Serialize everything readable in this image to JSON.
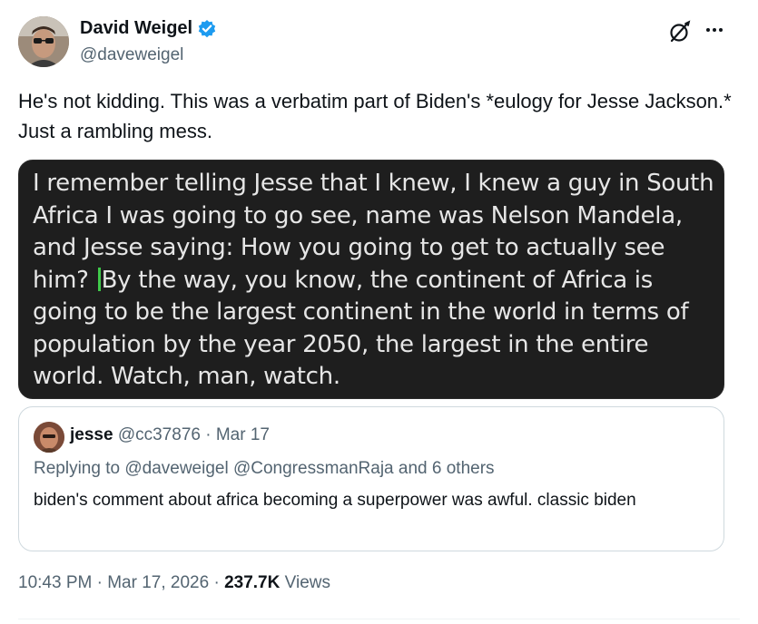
{
  "author": {
    "name": "David Weigel",
    "handle": "@daveweigel",
    "verified_color": "#1d9bf0"
  },
  "tweet": {
    "text": "He's not kidding. This was a verbatim part of Biden's *eulogy for Jesse Jackson.* Just a rambling mess."
  },
  "media": {
    "text_before_cursor": "I remember telling Jesse that I knew, I knew a guy in South Africa I was going to go see, name was Nelson Mandela, and Jesse saying: How you going to get to actually see him?",
    "text_after_cursor": "By the way, you know, the continent of Africa is going to be the largest continent in the world in terms of population by the year 2050, the largest in the entire world. Watch, man, watch.",
    "background": "#1e1e1e",
    "cursor_color": "#3fc94a"
  },
  "quote": {
    "name": "jesse",
    "handle": "@cc37876",
    "separator": "·",
    "date": "Mar 17",
    "replying_prefix": "Replying to ",
    "replying_mentions": "@daveweigel @CongressmanRaja",
    "replying_suffix": " and 6 others",
    "text": "biden's comment about africa becoming a superpower was awful. classic biden"
  },
  "meta": {
    "time": "10:43 PM",
    "separator": " · ",
    "date": "Mar 17, 2026",
    "separator2": " · ",
    "views_count": "237.7K",
    "views_label": " Views"
  },
  "icons": {
    "grok": "grok-icon",
    "more": "more-icon",
    "verified": "verified-badge-icon"
  }
}
